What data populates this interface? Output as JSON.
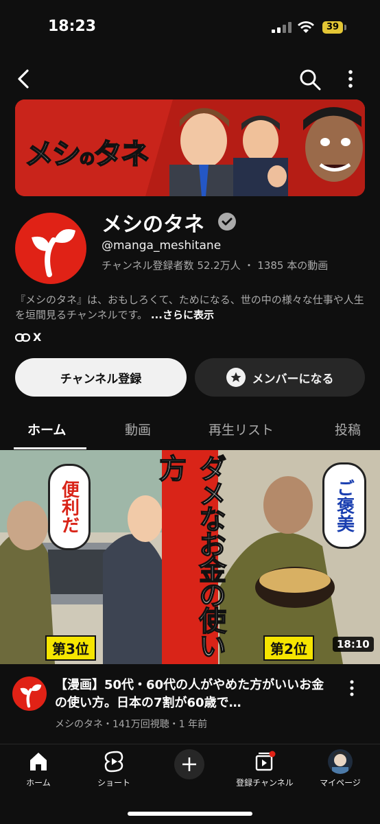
{
  "status_bar": {
    "time": "18:23",
    "battery": "39"
  },
  "banner": {
    "logo_main": "メシ",
    "logo_small": "の",
    "logo_end": "タネ"
  },
  "channel": {
    "name": "メシのタネ",
    "handle": "@manga_meshitane",
    "subscribers": "チャンネル登録者数 52.2万人",
    "separator": "・",
    "video_count": "1385 本の動画",
    "description": "『メシのタネ』は、おもしろくて、ためになる、世の中の様々な仕事や人生を垣間見るチャンネルです。",
    "more_label": "...さらに表示",
    "link_label": "X"
  },
  "buttons": {
    "subscribe": "チャンネル登録",
    "member": "メンバーになる"
  },
  "tabs": [
    {
      "label": "ホーム"
    },
    {
      "label": "動画"
    },
    {
      "label": "再生リスト"
    },
    {
      "label": "投稿"
    }
  ],
  "video": {
    "thumb_text": {
      "left_bubble": "便利だ",
      "left_rank": "第3位",
      "center": "ダメなお金の使い方",
      "right_bubble": "ご褒美",
      "right_rank": "第2位"
    },
    "duration": "18:10",
    "title": "【漫画】50代・60代の人がやめた方がいいお金の使い方。日本の7割が60歳で…",
    "meta": "メシのタネ・141万回視聴・1 年前"
  },
  "bottom_nav": [
    {
      "label": "ホーム",
      "icon": "home-icon"
    },
    {
      "label": "ショート",
      "icon": "shorts-icon"
    },
    {
      "label": "",
      "icon": "create-icon"
    },
    {
      "label": "登録チャンネル",
      "icon": "subscriptions-icon"
    },
    {
      "label": "マイページ",
      "icon": "profile-icon"
    }
  ],
  "colors": {
    "brand_red": "#e02216",
    "background": "#0f0f0f",
    "accent_yellow": "#f6e500"
  }
}
